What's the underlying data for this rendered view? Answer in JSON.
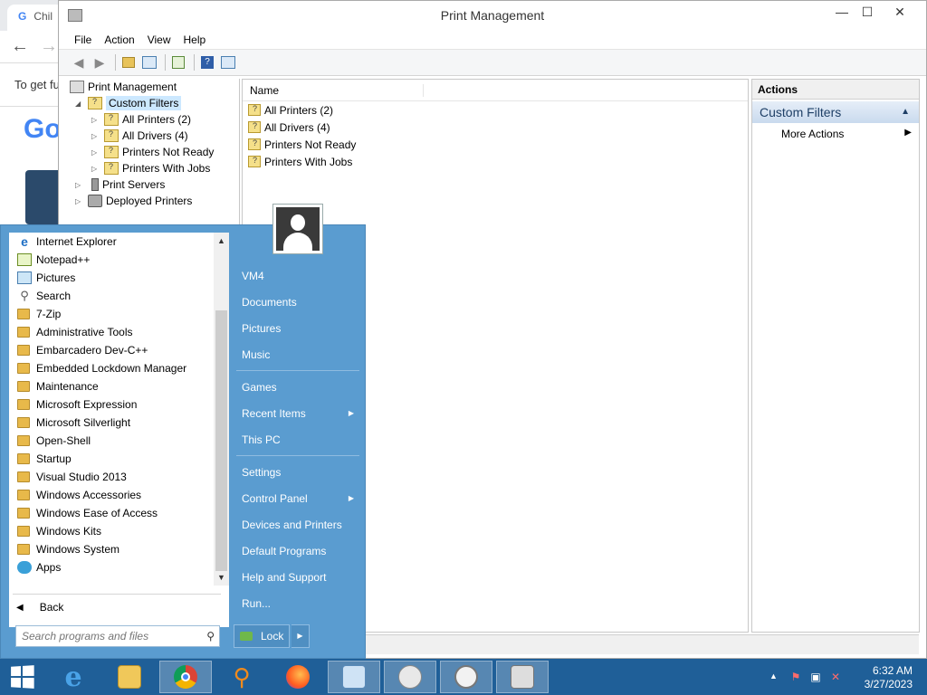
{
  "chrome": {
    "tab_title": "Chil",
    "page_text": "To get fu",
    "logo_text": "Go"
  },
  "window": {
    "title": "Print Management",
    "minimize": "—",
    "maximize": "☐",
    "close": "✕"
  },
  "menubar": [
    "File",
    "Action",
    "View",
    "Help"
  ],
  "tree": {
    "root": "Print Management",
    "custom_filters": "Custom Filters",
    "filters": [
      "All Printers (2)",
      "All Drivers (4)",
      "Printers Not Ready",
      "Printers With Jobs"
    ],
    "print_servers": "Print Servers",
    "deployed_printers": "Deployed Printers"
  },
  "list": {
    "column_name": "Name",
    "rows": [
      "All Printers (2)",
      "All Drivers (4)",
      "Printers Not Ready",
      "Printers With Jobs"
    ]
  },
  "actions": {
    "header": "Actions",
    "section": "Custom Filters",
    "more_actions": "More Actions"
  },
  "start_menu": {
    "programs": [
      {
        "label": "Internet Explorer",
        "icon": "internet-explorer-icon"
      },
      {
        "label": "Notepad++",
        "icon": "notepad-icon"
      },
      {
        "label": "Pictures",
        "icon": "pictures-icon"
      },
      {
        "label": "Search",
        "icon": "search-icon"
      },
      {
        "label": "7-Zip",
        "icon": "folder-icon"
      },
      {
        "label": "Administrative Tools",
        "icon": "folder-icon"
      },
      {
        "label": "Embarcadero Dev-C++",
        "icon": "folder-icon"
      },
      {
        "label": "Embedded Lockdown Manager",
        "icon": "folder-icon"
      },
      {
        "label": "Maintenance",
        "icon": "folder-icon"
      },
      {
        "label": "Microsoft Expression",
        "icon": "folder-icon"
      },
      {
        "label": "Microsoft Silverlight",
        "icon": "folder-icon"
      },
      {
        "label": "Open-Shell",
        "icon": "folder-icon"
      },
      {
        "label": "Startup",
        "icon": "folder-icon"
      },
      {
        "label": "Visual Studio 2013",
        "icon": "folder-icon"
      },
      {
        "label": "Windows Accessories",
        "icon": "folder-icon"
      },
      {
        "label": "Windows Ease of Access",
        "icon": "folder-icon"
      },
      {
        "label": "Windows Kits",
        "icon": "folder-icon"
      },
      {
        "label": "Windows System",
        "icon": "folder-icon"
      },
      {
        "label": "Apps",
        "icon": "apps-icon"
      }
    ],
    "back": "Back",
    "search_placeholder": "Search programs and files",
    "right_items": {
      "vm4": "VM4",
      "documents": "Documents",
      "pictures": "Pictures",
      "music": "Music",
      "games": "Games",
      "recent_items": "Recent Items",
      "this_pc": "This PC",
      "settings": "Settings",
      "control_panel": "Control Panel",
      "devices_printers": "Devices and Printers",
      "default_programs": "Default Programs",
      "help_support": "Help and Support",
      "run": "Run..."
    },
    "lock": "Lock"
  },
  "taskbar": {
    "apps": [
      "internet-explorer",
      "file-explorer",
      "chrome",
      "search-tool",
      "firefox",
      "control-panel",
      "snipping-tool",
      "clock",
      "print-management"
    ],
    "time": "6:32 AM",
    "date": "3/27/2023"
  },
  "colors": {
    "start_menu_bg": "#5a9cd0",
    "taskbar_bg": "#1f5f98",
    "selection": "#cce8ff"
  }
}
